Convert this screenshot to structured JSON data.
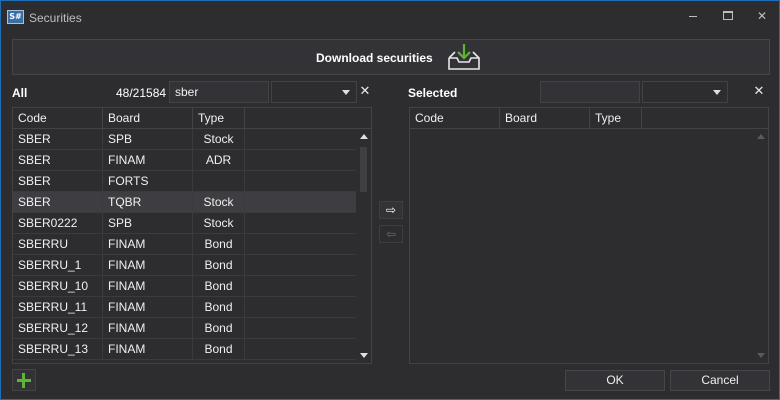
{
  "window": {
    "title": "Securities",
    "icon_text": "S#"
  },
  "download": {
    "label": "Download securities",
    "icon": "download-tray-icon"
  },
  "left": {
    "label": "All",
    "count": "48/21584",
    "search_value": "sber",
    "columns": [
      "Code",
      "Board",
      "Type"
    ],
    "rows": [
      {
        "code": "SBER",
        "board": "SPB",
        "type": "Stock"
      },
      {
        "code": "SBER",
        "board": "FINAM",
        "type": "ADR"
      },
      {
        "code": "SBER",
        "board": "FORTS",
        "type": ""
      },
      {
        "code": "SBER",
        "board": "TQBR",
        "type": "Stock"
      },
      {
        "code": "SBER0222",
        "board": "SPB",
        "type": "Stock"
      },
      {
        "code": "SBERRU",
        "board": "FINAM",
        "type": "Bond"
      },
      {
        "code": "SBERRU_1",
        "board": "FINAM",
        "type": "Bond"
      },
      {
        "code": "SBERRU_10",
        "board": "FINAM",
        "type": "Bond"
      },
      {
        "code": "SBERRU_11",
        "board": "FINAM",
        "type": "Bond"
      },
      {
        "code": "SBERRU_12",
        "board": "FINAM",
        "type": "Bond"
      },
      {
        "code": "SBERRU_13",
        "board": "FINAM",
        "type": "Bond"
      }
    ],
    "selected_row": 3
  },
  "right": {
    "label": "Selected",
    "columns": [
      "Code",
      "Board",
      "Type"
    ]
  },
  "buttons": {
    "ok": "OK",
    "cancel": "Cancel",
    "add_icon": "plus-icon"
  },
  "colors": {
    "accent_green": "#5fb336",
    "window_border": "#1e6fb8"
  }
}
